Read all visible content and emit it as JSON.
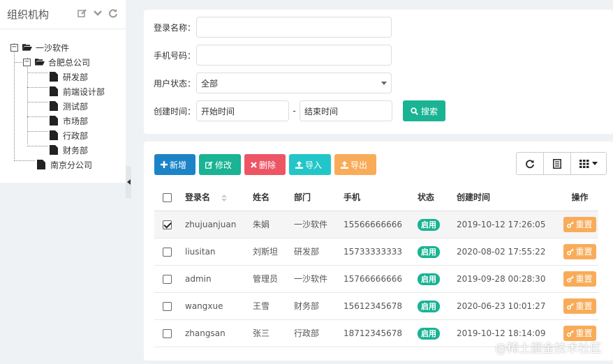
{
  "left_panel": {
    "title": "组织机构",
    "tree": [
      {
        "label": "一沙软件"
      },
      {
        "label": "合肥总公司"
      },
      {
        "label": "研发部"
      },
      {
        "label": "前端设计部"
      },
      {
        "label": "测试部"
      },
      {
        "label": "市场部"
      },
      {
        "label": "行政部"
      },
      {
        "label": "财务部"
      },
      {
        "label": "南京分公司"
      }
    ]
  },
  "search": {
    "login_name_label": "登录名称：",
    "login_name_value": "",
    "phone_label": "手机号码：",
    "phone_value": "",
    "status_label": "用户状态：",
    "status_value": "全部",
    "created_label": "创建时间：",
    "start_placeholder": "开始时间",
    "range_sep": "-",
    "end_placeholder": "结束时间",
    "search_button": "搜索"
  },
  "toolbar": {
    "add": "新增",
    "edit": "修改",
    "delete": "删除",
    "import": "导入",
    "export": "导出"
  },
  "table": {
    "headers": [
      "登录名",
      "姓名",
      "部门",
      "手机",
      "状态",
      "创建时间",
      "操作"
    ],
    "rows": [
      {
        "checked": true,
        "login": "zhujuanjuan",
        "name": "朱娟",
        "dept": "一沙软件",
        "phone": "15566666666",
        "status": "启用",
        "created": "2019-10-12 17:26:05",
        "action": "重置"
      },
      {
        "checked": false,
        "login": "liusitan",
        "name": "刘斯坦",
        "dept": "研发部",
        "phone": "15733333333",
        "status": "启用",
        "created": "2020-08-02 17:55:22",
        "action": "重置"
      },
      {
        "checked": false,
        "login": "admin",
        "name": "管理员",
        "dept": "一沙软件",
        "phone": "15766666666",
        "status": "启用",
        "created": "2019-09-28 00:28:30",
        "action": "重置"
      },
      {
        "checked": false,
        "login": "wangxue",
        "name": "王雪",
        "dept": "财务部",
        "phone": "15612345678",
        "status": "启用",
        "created": "2020-06-23 10:01:27",
        "action": "重置"
      },
      {
        "checked": false,
        "login": "zhangsan",
        "name": "张三",
        "dept": "行政部",
        "phone": "18712345678",
        "status": "启用",
        "created": "2019-10-12 18:14:09",
        "action": "重置"
      }
    ]
  },
  "watermark": "@稀土掘金技术社区",
  "colors": {
    "primary": "#1c84c6",
    "success": "#1ab394",
    "danger": "#ed5565",
    "info": "#23c6c8",
    "warning": "#f8ac59"
  }
}
